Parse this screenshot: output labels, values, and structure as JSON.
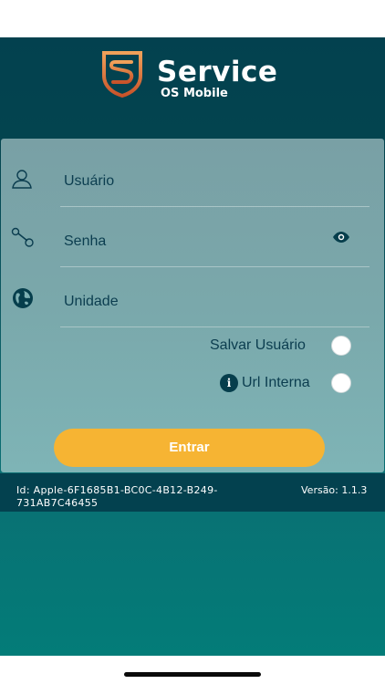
{
  "brand": {
    "title": "Service",
    "subtitle": "OS Mobile",
    "logo_icon": "shield-s-logo"
  },
  "login": {
    "username_placeholder": "Usuário",
    "password_placeholder": "Senha",
    "unit_placeholder": "Unidade",
    "save_user_label": "Salvar Usuário",
    "internal_url_label": "Url Interna",
    "info_symbol": "i",
    "submit_label": "Entrar"
  },
  "icons": {
    "username": "user-icon",
    "password": "key-icon",
    "unit": "globe-icon",
    "show_password": "eye-icon",
    "info": "info-icon"
  },
  "footer": {
    "device_id": "Id: Apple-6F1685B1-BC0C-4B12-B249-731AB7C46455",
    "version": "Versão: 1.1.3"
  },
  "colors": {
    "header_bg": "#03414f",
    "accent_button": "#f6b433",
    "text_dark": "#0b3d4f",
    "logo_orange": "#e07a3a"
  }
}
